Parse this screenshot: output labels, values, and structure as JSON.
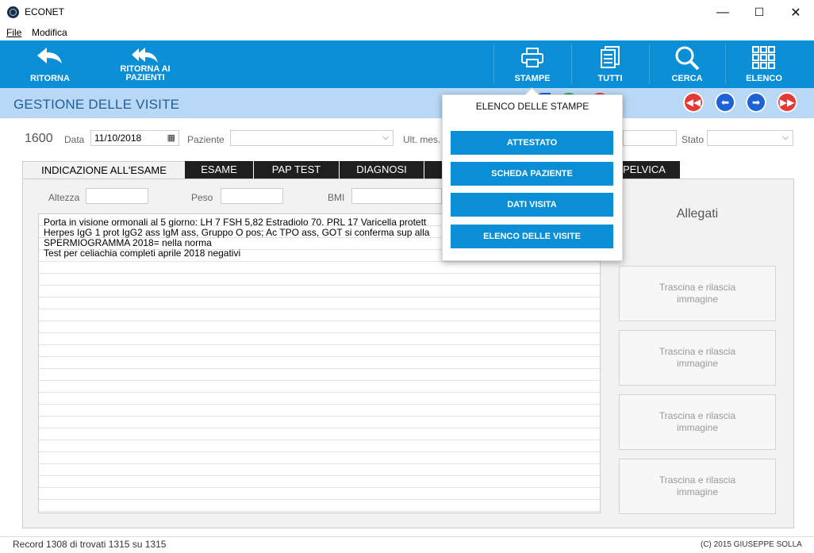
{
  "window": {
    "title": "ECONET",
    "minimize": "—",
    "maximize": "☐",
    "close": "✕"
  },
  "menu": {
    "file": "File",
    "modifica": "Modifica"
  },
  "toolbar": {
    "ritorna": "RITORNA",
    "ritorna_pazienti_1": "RITORNA AI",
    "ritorna_pazienti_2": "PAZIENTI",
    "stampe": "STAMPE",
    "tutti": "TUTTI",
    "cerca": "CERCA",
    "elenco": "ELENCO"
  },
  "header": {
    "title": "GESTIONE DELLE VISITE",
    "nav_colors": {
      "first": "#e53935",
      "prev": "#1e63d6",
      "next": "#1e63d6",
      "last": "#e53935"
    }
  },
  "form": {
    "record_number": "1600",
    "data_label": "Data",
    "data_value": "11/10/2018",
    "paziente_label": "Paziente",
    "paziente_value": "",
    "ult_mes_label": "Ult. mes.",
    "stato_label": "Stato",
    "stato_value": ""
  },
  "tabs": [
    {
      "label": "INDICAZIONE ALL'ESAME",
      "active": true
    },
    {
      "label": "ESAME"
    },
    {
      "label": "PAP TEST"
    },
    {
      "label": "DIAGNOSI"
    },
    {
      "label": ""
    },
    {
      "label": "PELVICA"
    }
  ],
  "measures": {
    "altezza_label": "Altezza",
    "peso_label": "Peso",
    "bmi_label": "BMI"
  },
  "notes": [
    "Porta in visione ormonali al 5 giorno: LH 7 FSH 5,82  Estradiolo 70. PRL 17   Varicella protett",
    "Herpes IgG 1 prot IgG2 ass IgM ass,  Gruppo O pos; Ac TPO ass, GOT si conferma sup alla",
    "SPERMIOGRAMMA 2018= nella norma",
    "Test per celiachia completi aprile 2018 negativi"
  ],
  "attachments": {
    "title": "Allegati",
    "dropzones": [
      {
        "line1": "Trascina e rilascia",
        "line2": "immagine"
      },
      {
        "line1": "Trascina e rilascia",
        "line2": "immagine"
      },
      {
        "line1": "Trascina e rilascia",
        "line2": "immagine"
      },
      {
        "line1": "Trascina e rilascia",
        "line2": "immagine"
      }
    ]
  },
  "popup": {
    "title": "ELENCO DELLE STAMPE",
    "buttons": [
      "ATTESTATO",
      "SCHEDA PAZIENTE",
      "DATI VISITA",
      "ELENCO DELLE VISITE"
    ]
  },
  "status": {
    "record": "Record 1308 di trovati 1315 su 1315",
    "copyright": "(C) 2015 GIUSEPPE SOLLA"
  },
  "colors": {
    "accent": "#0a8fd6",
    "header": "#b8d8f5",
    "title": "#1f5f99"
  }
}
